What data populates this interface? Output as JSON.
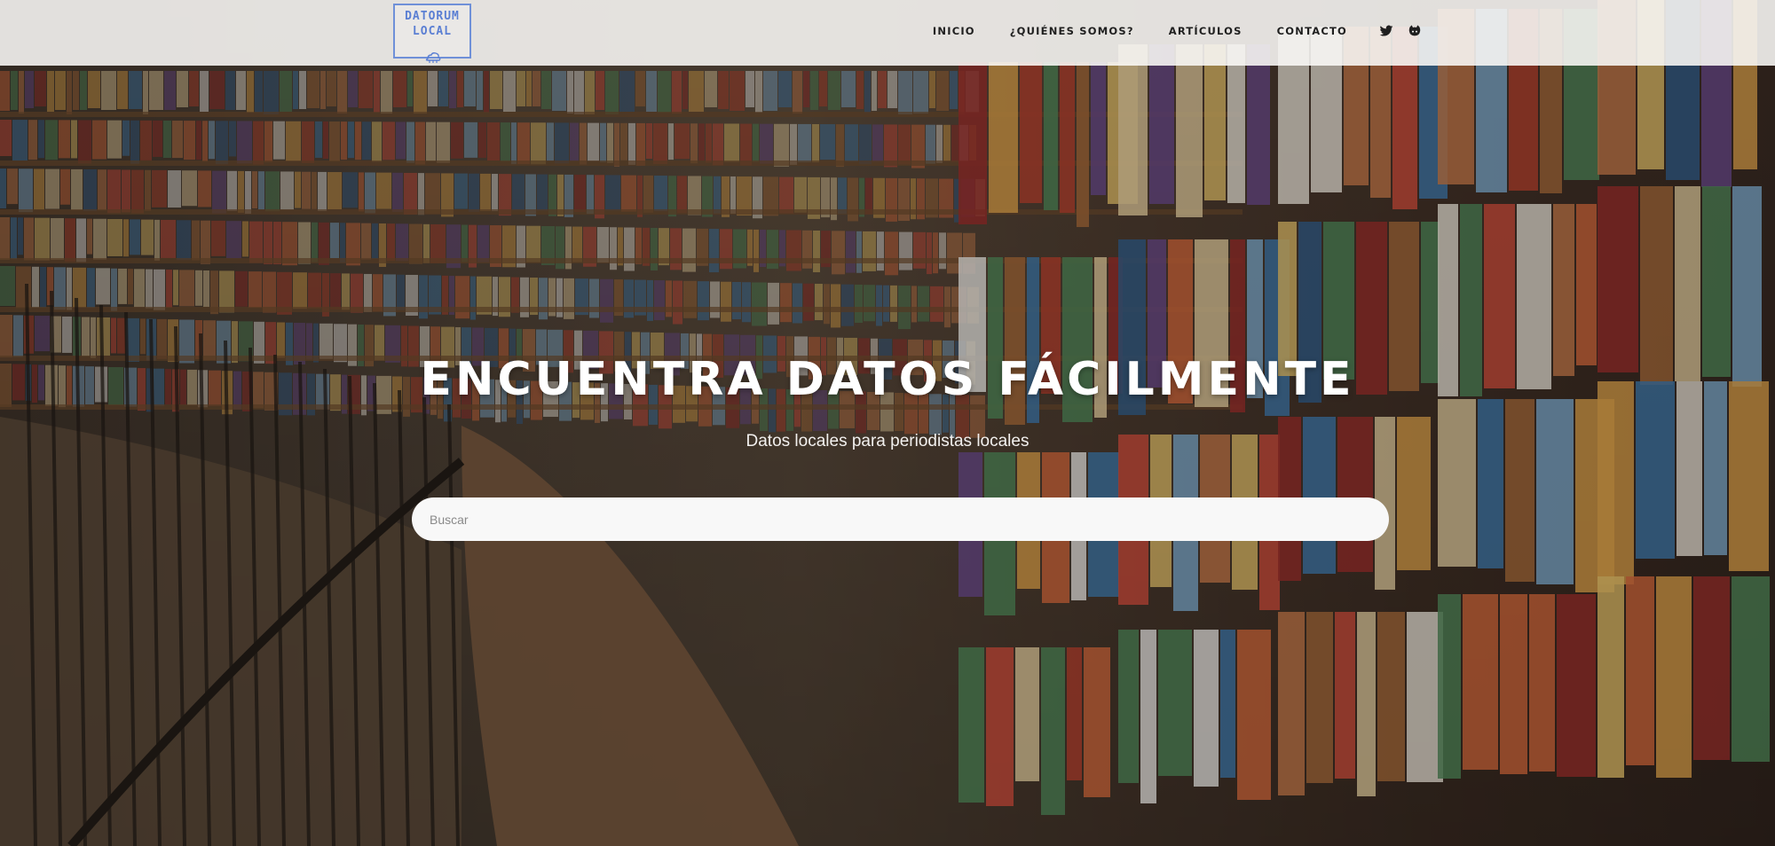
{
  "logo": {
    "line1": "DATORUM",
    "line2": "LOCAL"
  },
  "nav": {
    "items": [
      {
        "label": "INICIO"
      },
      {
        "label": "¿QUIÉNES SOMOS?"
      },
      {
        "label": "ARTÍCULOS"
      },
      {
        "label": "CONTACTO"
      }
    ],
    "social": [
      "twitter-icon",
      "github-icon"
    ]
  },
  "hero": {
    "title": "ENCUENTRA DATOS FÁCILMENTE",
    "subtitle": "Datos locales para periodistas locales"
  },
  "search": {
    "placeholder": "Buscar",
    "value": ""
  },
  "colors": {
    "logo_accent": "#5b7fd3",
    "navbar_bg": "#faf9f7",
    "search_bg": "#f8f8f8"
  }
}
